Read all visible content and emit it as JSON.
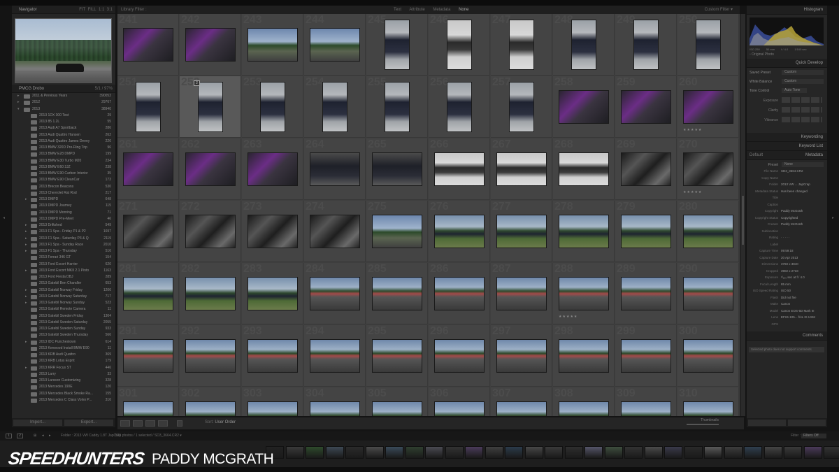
{
  "left_panel": {
    "navigator": {
      "title": "Navigator",
      "zoom_opts": [
        "FIT",
        "FILL",
        "1:1",
        "3:1"
      ]
    },
    "collection": {
      "title": "PMCG Drobo",
      "stats": "5/1 / 97%"
    },
    "folders": [
      {
        "name": "2011 & Previous Years",
        "count": "390052",
        "level": 0,
        "tri": "▸"
      },
      {
        "name": "2012",
        "count": "29767",
        "level": 0,
        "tri": "▸"
      },
      {
        "name": "2013",
        "count": "38940",
        "level": 0,
        "tri": "▾"
      },
      {
        "name": "2013 1DX 300 Test",
        "count": "29",
        "level": 1,
        "tri": ""
      },
      {
        "name": "2013 85 1.2L",
        "count": "55",
        "level": 1,
        "tri": ""
      },
      {
        "name": "2013 Audi A7 Sportback",
        "count": "286",
        "level": 1,
        "tri": ""
      },
      {
        "name": "2013 Audi Quattro Hansen",
        "count": "262",
        "level": 1,
        "tri": ""
      },
      {
        "name": "2013 Audi Quattro James Deeny",
        "count": "226",
        "level": 1,
        "tri": ""
      },
      {
        "name": "2013 BMW 320D Pre-Ring Trip",
        "count": "96",
        "level": 1,
        "tri": ""
      },
      {
        "name": "2013 BMW E28 DMPD",
        "count": "199",
        "level": 1,
        "tri": ""
      },
      {
        "name": "2013 BMW E30 Turbo M20",
        "count": "234",
        "level": 1,
        "tri": ""
      },
      {
        "name": "2013 BMW E60 2JZ",
        "count": "238",
        "level": 1,
        "tri": ""
      },
      {
        "name": "2013 BMW E90 Carbon Interior",
        "count": "35",
        "level": 1,
        "tri": ""
      },
      {
        "name": "2013 BMW E90 CleanCar",
        "count": "173",
        "level": 1,
        "tri": ""
      },
      {
        "name": "2013 Brecon Beacons",
        "count": "530",
        "level": 1,
        "tri": ""
      },
      {
        "name": "2013 Chevrolet Rat Rod",
        "count": "217",
        "level": 1,
        "tri": ""
      },
      {
        "name": "2013 DMPD",
        "count": "648",
        "level": 1,
        "tri": "▸"
      },
      {
        "name": "2013 DMPD Journey",
        "count": "115",
        "level": 1,
        "tri": ""
      },
      {
        "name": "2013 DMPD Morning",
        "count": "71",
        "level": 1,
        "tri": ""
      },
      {
        "name": "2013 DMPD Pre-Meet",
        "count": "46",
        "level": 1,
        "tri": ""
      },
      {
        "name": "2013 Driftshed",
        "count": "549",
        "level": 1,
        "tri": "▸"
      },
      {
        "name": "2013 F1 Spa - Friday P1 & P2",
        "count": "1697",
        "level": 1,
        "tri": "▸"
      },
      {
        "name": "2013 F1 Spa - Saturday P3 & Q",
        "count": "2119",
        "level": 1,
        "tri": "▸"
      },
      {
        "name": "2013 F1 Spa - Sunday Race",
        "count": "2010",
        "level": 1,
        "tri": "▸"
      },
      {
        "name": "2013 F1 Spa - Thursday",
        "count": "516",
        "level": 1,
        "tri": "▸"
      },
      {
        "name": "2013 Ferrari 346 GT",
        "count": "154",
        "level": 1,
        "tri": ""
      },
      {
        "name": "2013 Ford Escort Harrier",
        "count": "620",
        "level": 1,
        "tri": ""
      },
      {
        "name": "2013 Ford Escort MKII 2.1 Pinto",
        "count": "1163",
        "level": 1,
        "tri": "▸"
      },
      {
        "name": "2013 Ford Fiesta DBJ",
        "count": "289",
        "level": 1,
        "tri": ""
      },
      {
        "name": "2013 Gatebil Ben Chandler",
        "count": "653",
        "level": 1,
        "tri": ""
      },
      {
        "name": "2013 Gatebil Norway Friday",
        "count": "1206",
        "level": 1,
        "tri": "▸"
      },
      {
        "name": "2013 Gatebil Norway Saturday",
        "count": "717",
        "level": 1,
        "tri": "▸"
      },
      {
        "name": "2013 Gatebil Norway Sunday",
        "count": "523",
        "level": 1,
        "tri": "▸"
      },
      {
        "name": "2013 Gatebil Remote Camera",
        "count": "11",
        "level": 1,
        "tri": ""
      },
      {
        "name": "2013 Gatebil Sweden Friday",
        "count": "1304",
        "level": 1,
        "tri": ""
      },
      {
        "name": "2013 Gatebil Sweden Saturday",
        "count": "2055",
        "level": 1,
        "tri": ""
      },
      {
        "name": "2013 Gatebil Sweden Sunday",
        "count": "933",
        "level": 1,
        "tri": ""
      },
      {
        "name": "2013 Gatebil Sweden Thursday",
        "count": "566",
        "level": 1,
        "tri": ""
      },
      {
        "name": "2013 IDC Punchestown",
        "count": "614",
        "level": 1,
        "tri": "▸"
      },
      {
        "name": "2013 Kenwood Install BMW E90",
        "count": "11",
        "level": 1,
        "tri": ""
      },
      {
        "name": "2013 KRB Audi Quattro",
        "count": "369",
        "level": 1,
        "tri": ""
      },
      {
        "name": "2013 KRB Lotus Esprit",
        "count": "179",
        "level": 1,
        "tri": ""
      },
      {
        "name": "2013 KRR Focus ST",
        "count": "446",
        "level": 1,
        "tri": "▸"
      },
      {
        "name": "2013 Larry",
        "count": "33",
        "level": 1,
        "tri": ""
      },
      {
        "name": "2013 Larsson Customizing",
        "count": "328",
        "level": 1,
        "tri": ""
      },
      {
        "name": "2013 Mercedes 190E",
        "count": "120",
        "level": 1,
        "tri": ""
      },
      {
        "name": "2013 Mercedes Black Smoke Ra...",
        "count": "155",
        "level": 1,
        "tri": ""
      },
      {
        "name": "2013 Mercedes C Class Volvo P...",
        "count": "316",
        "level": 1,
        "tri": ""
      }
    ],
    "import_label": "Import...",
    "export_label": "Export..."
  },
  "filter_bar": {
    "title": "Library Filter :",
    "opts": [
      "Text",
      "Attribute",
      "Metadata"
    ],
    "none": "None",
    "lock": "Custom Filter ▾"
  },
  "grid": {
    "cols": 10,
    "start_number": 241,
    "selected_index": 11,
    "photos": [
      {
        "o": "land",
        "c": "eng"
      },
      {
        "o": "land",
        "c": "eng"
      },
      {
        "o": "land",
        "c": "sky"
      },
      {
        "o": "land",
        "c": "sky"
      },
      {
        "o": "port",
        "c": "car"
      },
      {
        "o": "port",
        "c": "white"
      },
      {
        "o": "port",
        "c": "white"
      },
      {
        "o": "port",
        "c": "car"
      },
      {
        "o": "port",
        "c": "car"
      },
      {
        "o": "port",
        "c": "car"
      },
      {
        "o": "port",
        "c": "car"
      },
      {
        "o": "port",
        "c": "car",
        "badge": "2"
      },
      {
        "o": "port",
        "c": "car"
      },
      {
        "o": "port",
        "c": "car"
      },
      {
        "o": "port",
        "c": "car"
      },
      {
        "o": "port",
        "c": "car"
      },
      {
        "o": "port",
        "c": "car"
      },
      {
        "o": "land",
        "c": "eng"
      },
      {
        "o": "land",
        "c": "eng"
      },
      {
        "o": "land",
        "c": "eng",
        "stars": "★★★★★"
      },
      {
        "o": "land",
        "c": "eng"
      },
      {
        "o": "land",
        "c": "eng"
      },
      {
        "o": "land",
        "c": "eng"
      },
      {
        "o": "land",
        "c": "dark"
      },
      {
        "o": "land",
        "c": "dark"
      },
      {
        "o": "land",
        "c": "white"
      },
      {
        "o": "land",
        "c": "white"
      },
      {
        "o": "land",
        "c": "white"
      },
      {
        "o": "land",
        "c": "bay"
      },
      {
        "o": "land",
        "c": "bay",
        "stars": "★★★★★"
      },
      {
        "o": "land",
        "c": "bay"
      },
      {
        "o": "land",
        "c": "bay"
      },
      {
        "o": "land",
        "c": "bay"
      },
      {
        "o": "land",
        "c": "bay"
      },
      {
        "o": "land",
        "c": "sky"
      },
      {
        "o": "land",
        "c": "field"
      },
      {
        "o": "land",
        "c": "field"
      },
      {
        "o": "land",
        "c": "field"
      },
      {
        "o": "land",
        "c": "field"
      },
      {
        "o": "land",
        "c": "field"
      },
      {
        "o": "land",
        "c": "field"
      },
      {
        "o": "land",
        "c": "field"
      },
      {
        "o": "land",
        "c": "field"
      },
      {
        "o": "land",
        "c": "track"
      },
      {
        "o": "land",
        "c": "track"
      },
      {
        "o": "land",
        "c": "track"
      },
      {
        "o": "land",
        "c": "track"
      },
      {
        "o": "land",
        "c": "track",
        "stars": "★★★★★"
      },
      {
        "o": "land",
        "c": "track"
      },
      {
        "o": "land",
        "c": "track"
      },
      {
        "o": "land",
        "c": "track"
      },
      {
        "o": "land",
        "c": "track"
      },
      {
        "o": "land",
        "c": "track"
      },
      {
        "o": "land",
        "c": "track"
      },
      {
        "o": "land",
        "c": "track"
      },
      {
        "o": "land",
        "c": "track"
      },
      {
        "o": "land",
        "c": "track"
      },
      {
        "o": "land",
        "c": "track"
      },
      {
        "o": "land",
        "c": "track"
      },
      {
        "o": "land",
        "c": "track"
      },
      {
        "o": "land",
        "c": "track"
      },
      {
        "o": "land",
        "c": "track"
      },
      {
        "o": "land",
        "c": "track"
      },
      {
        "o": "land",
        "c": "track"
      },
      {
        "o": "land",
        "c": "track"
      },
      {
        "o": "land",
        "c": "track"
      },
      {
        "o": "land",
        "c": "track"
      },
      {
        "o": "land",
        "c": "track"
      },
      {
        "o": "land",
        "c": "track"
      },
      {
        "o": "land",
        "c": "track"
      }
    ]
  },
  "toolbar": {
    "sort_label": "Sort:",
    "sort_value": "User Order",
    "thumbnails_label": "Thumbnails"
  },
  "right_panel": {
    "histogram_title": "Histogram",
    "histo_meta": [
      "ISO 250",
      "50 mm",
      "f / 4.0",
      "1/160 sec"
    ],
    "original_photo": "Original Photo",
    "quick_develop": {
      "title": "Quick Develop",
      "saved_preset_label": "Saved Preset",
      "saved_preset_value": "Custom",
      "white_balance_label": "White Balance",
      "white_balance_value": "Custom",
      "tone_control_label": "Tone Control",
      "auto_tone": "Auto Tone",
      "rows": [
        "Exposure",
        "Clarity",
        "Vibrance"
      ]
    },
    "keywording": "Keywording",
    "keyword_list": "Keyword List",
    "metadata_title": "Metadata",
    "metadata_default": "Default",
    "metadata_preset_label": "Preset",
    "metadata_preset_value": "None",
    "metadata": [
      {
        "k": "File Name",
        "v": "SD3_3664.CR2"
      },
      {
        "k": "Copy Name",
        "v": ""
      },
      {
        "k": "Folder",
        "v": "2013 VW ... JapCrap"
      },
      {
        "k": "Metadata Status",
        "v": "Has been changed"
      },
      {
        "k": "Title",
        "v": ""
      },
      {
        "k": "Caption",
        "v": ""
      },
      {
        "k": "Copyright",
        "v": "Paddy McGrath"
      },
      {
        "k": "Copyright Status",
        "v": "Copyrighted"
      },
      {
        "k": "Creator",
        "v": "Paddy McGrath"
      },
      {
        "k": "Sublocation",
        "v": ""
      },
      {
        "k": "Rating",
        "v": "· · · · ·"
      },
      {
        "k": "Label",
        "v": ""
      },
      {
        "k": "Capture Time",
        "v": "09:59:18"
      },
      {
        "k": "Capture Date",
        "v": "20 Apr 2013"
      },
      {
        "k": "Dimensions",
        "v": "3760 x 3840"
      },
      {
        "k": "Cropped",
        "v": "3902 x 2733"
      },
      {
        "k": "Exposure",
        "v": "¹/₁₆₀ sec at f / 4.0"
      },
      {
        "k": "Focal Length",
        "v": "85 mm"
      },
      {
        "k": "ISO Speed Rating",
        "v": "ISO 50"
      },
      {
        "k": "Flash",
        "v": "Did not fire"
      },
      {
        "k": "Make",
        "v": "Canon"
      },
      {
        "k": "Model",
        "v": "Canon EOS-5D Mark III"
      },
      {
        "k": "Lens",
        "v": "EF24-105... f/4L IS USM"
      },
      {
        "k": "GPS",
        "v": ""
      }
    ],
    "comments_title": "Comments",
    "comments_placeholder": "Selected photo does not support comments"
  },
  "filmstrip_info": {
    "pages": [
      "1",
      "2"
    ],
    "folder": "Folder : 2013 VW Caddy 1.8T JapCrap",
    "count": "521 photos / 1 selected / SD3_3664.CR2 ▾",
    "filter_label": "Filter :",
    "filter_value": "Filters Off"
  },
  "filmstrip_colors": [
    "#222",
    "#3a3a3a",
    "#2e4a2c",
    "#3d4854",
    "#2b2b2b",
    "#4a4a4a",
    "#3a4a5a",
    "#2f3f2f",
    "#4a4a52",
    "#333",
    "#4b3b5b",
    "#3f3f3f",
    "#2b3b4b",
    "#474747",
    "#3a3a3a",
    "#2e2e2e",
    "#55556a",
    "#3e4e3e",
    "#333",
    "#4b4b4b",
    "#3a3a4a",
    "#2a2a2a",
    "#5a5a5a",
    "#3d3d3d",
    "#2f3f4f",
    "#444",
    "#3a3a3a",
    "#4a3a5a",
    "#333",
    "#555",
    "#2b2b2b",
    "#3e3e4e",
    "#454545",
    "#2e2e2e",
    "#505060",
    "#383838",
    "#3f3f3f",
    "#4a4a4a",
    "#333",
    "#2d3d2d",
    "#474757",
    "#3a3a3a",
    "#2f2f2f"
  ],
  "brand": {
    "name": "SPEEDHUNTERS",
    "author": "PADDY MCGRATH"
  }
}
